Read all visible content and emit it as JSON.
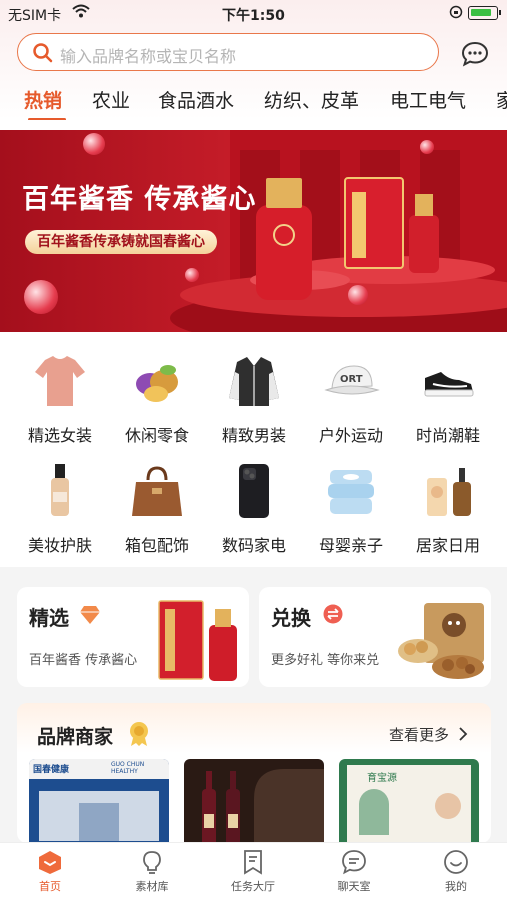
{
  "status_bar": {
    "carrier": "无SIM卡",
    "time": "下午1:50"
  },
  "search": {
    "placeholder": "输入品牌名称或宝贝名称"
  },
  "category_tabs": [
    "热销",
    "农业",
    "食品酒水",
    "纺织、皮革",
    "电工电气",
    "家"
  ],
  "banner": {
    "title": "百年酱香 传承酱心",
    "subtitle": "百年酱香传承铸就国春酱心",
    "product_text": "国春"
  },
  "categories": [
    {
      "label": "精选女装",
      "icon": "tshirt-icon"
    },
    {
      "label": "休闲零食",
      "icon": "snack-icon"
    },
    {
      "label": "精致男装",
      "icon": "jacket-icon"
    },
    {
      "label": "户外运动",
      "icon": "cap-icon"
    },
    {
      "label": "时尚潮鞋",
      "icon": "sneaker-icon"
    },
    {
      "label": "美妆护肤",
      "icon": "cosmetics-icon"
    },
    {
      "label": "箱包配饰",
      "icon": "handbag-icon"
    },
    {
      "label": "数码家电",
      "icon": "phone-icon"
    },
    {
      "label": "母婴亲子",
      "icon": "wipes-icon"
    },
    {
      "label": "居家日用",
      "icon": "bottles-icon"
    }
  ],
  "promos": [
    {
      "title": "精选",
      "subtitle": "百年酱香 传承酱心",
      "badge": "diamond-icon"
    },
    {
      "title": "兑换",
      "subtitle": "更多好礼 等你来兑",
      "badge": "exchange-icon"
    }
  ],
  "brands": {
    "title": "品牌商家",
    "more": "查看更多",
    "card1_name": "国春健康",
    "card1_en": "GUO CHUN HEALTHY",
    "card3_text": "育宝源"
  },
  "tabbar": [
    {
      "label": "首页",
      "active": true
    },
    {
      "label": "素材库",
      "active": false
    },
    {
      "label": "任务大厅",
      "active": false
    },
    {
      "label": "聊天室",
      "active": false
    },
    {
      "label": "我的",
      "active": false
    }
  ],
  "colors": {
    "accent": "#e65a2c",
    "banner_red": "#c41c28"
  }
}
